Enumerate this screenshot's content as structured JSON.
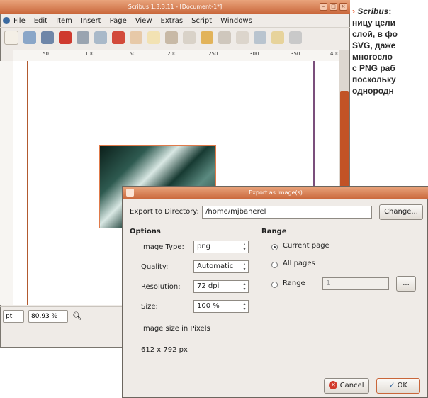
{
  "window": {
    "title": "Scribus 1.3.3.11 - [Document-1*]",
    "menu": [
      "File",
      "Edit",
      "Item",
      "Insert",
      "Page",
      "View",
      "Extras",
      "Script",
      "Windows"
    ]
  },
  "ruler": {
    "ticks": [
      "50",
      "100",
      "150",
      "200",
      "250",
      "300",
      "350",
      "400"
    ]
  },
  "statusbar": {
    "unit": "pt",
    "zoom": "80.93 %"
  },
  "caption": {
    "arrow": "›",
    "app": "Scribus",
    "lines": [
      ": ",
      "ницу цели",
      "слой, в фо",
      "SVG, даже",
      "многосло",
      "с PNG раб",
      "поскольку",
      "однородн"
    ]
  },
  "dialog": {
    "title": "Export as Image(s)",
    "export_dir_label": "Export to Directory:",
    "export_dir_value": "/home/mjbanerel",
    "change_button": "Change...",
    "options_heading": "Options",
    "image_type_label": "Image Type:",
    "image_type_value": "png",
    "quality_label": "Quality:",
    "quality_value": "Automatic",
    "resolution_label": "Resolution:",
    "resolution_value": "72 dpi",
    "size_label": "Size:",
    "size_value": "100 %",
    "image_size_label": "Image size in Pixels",
    "image_size_value": "612 x 792 px",
    "range_heading": "Range",
    "range_current": "Current page",
    "range_all": "All pages",
    "range_custom": "Range",
    "range_value": "1",
    "range_browse": "...",
    "cancel_button": "Cancel",
    "ok_button": "OK"
  },
  "colors": {
    "accent": "#c9663a",
    "caption_arrow": "#e8531f"
  }
}
